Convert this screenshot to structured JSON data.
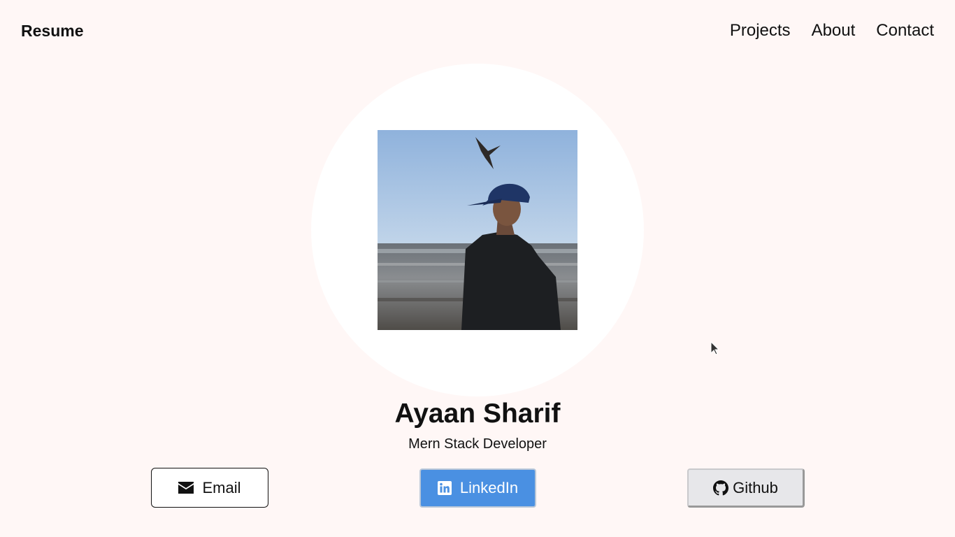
{
  "nav": {
    "brand": "Resume",
    "links": [
      "Projects",
      "About",
      "Contact"
    ]
  },
  "profile": {
    "name": "Ayaan Sharif",
    "title": "Mern Stack Developer",
    "photo_icon": "profile-photo"
  },
  "buttons": {
    "email": {
      "label": "Email",
      "icon": "envelope-icon"
    },
    "linkedin": {
      "label": "LinkedIn",
      "icon": "linkedin-icon"
    },
    "github": {
      "label": "Github",
      "icon": "github-icon"
    }
  },
  "colors": {
    "background": "#fff7f6",
    "linkedin_accent": "#4a90e2",
    "github_bg": "#e7e7ea"
  }
}
